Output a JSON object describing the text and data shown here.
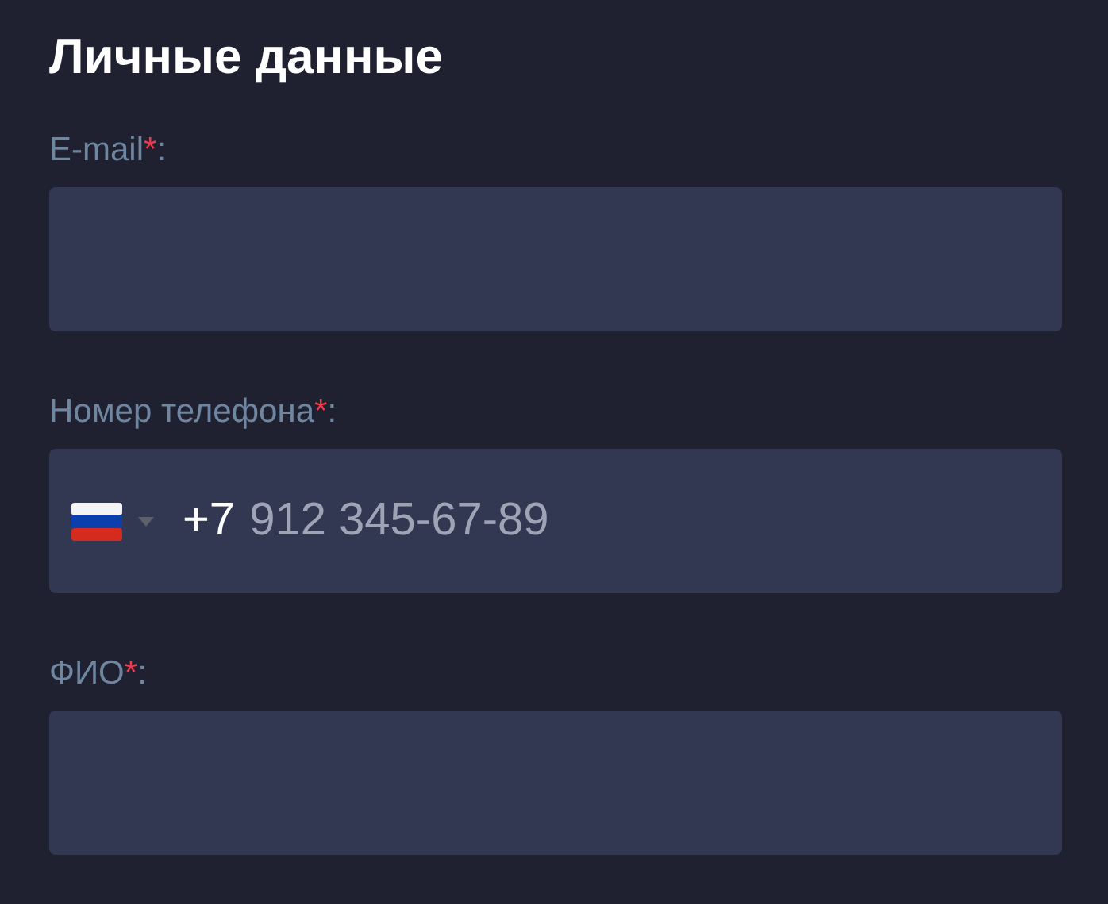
{
  "title": "Личные данные",
  "fields": [
    {
      "kind": "text",
      "label": "E-mail",
      "mark": "*",
      "colon": ":"
    },
    {
      "kind": "phone",
      "label": "Номер телефона",
      "mark": "*",
      "colon": ":",
      "prefix": "+7",
      "placeholder": "912 345-67-89"
    },
    {
      "kind": "text",
      "label": "ФИО",
      "mark": "*",
      "colon": ":"
    }
  ]
}
